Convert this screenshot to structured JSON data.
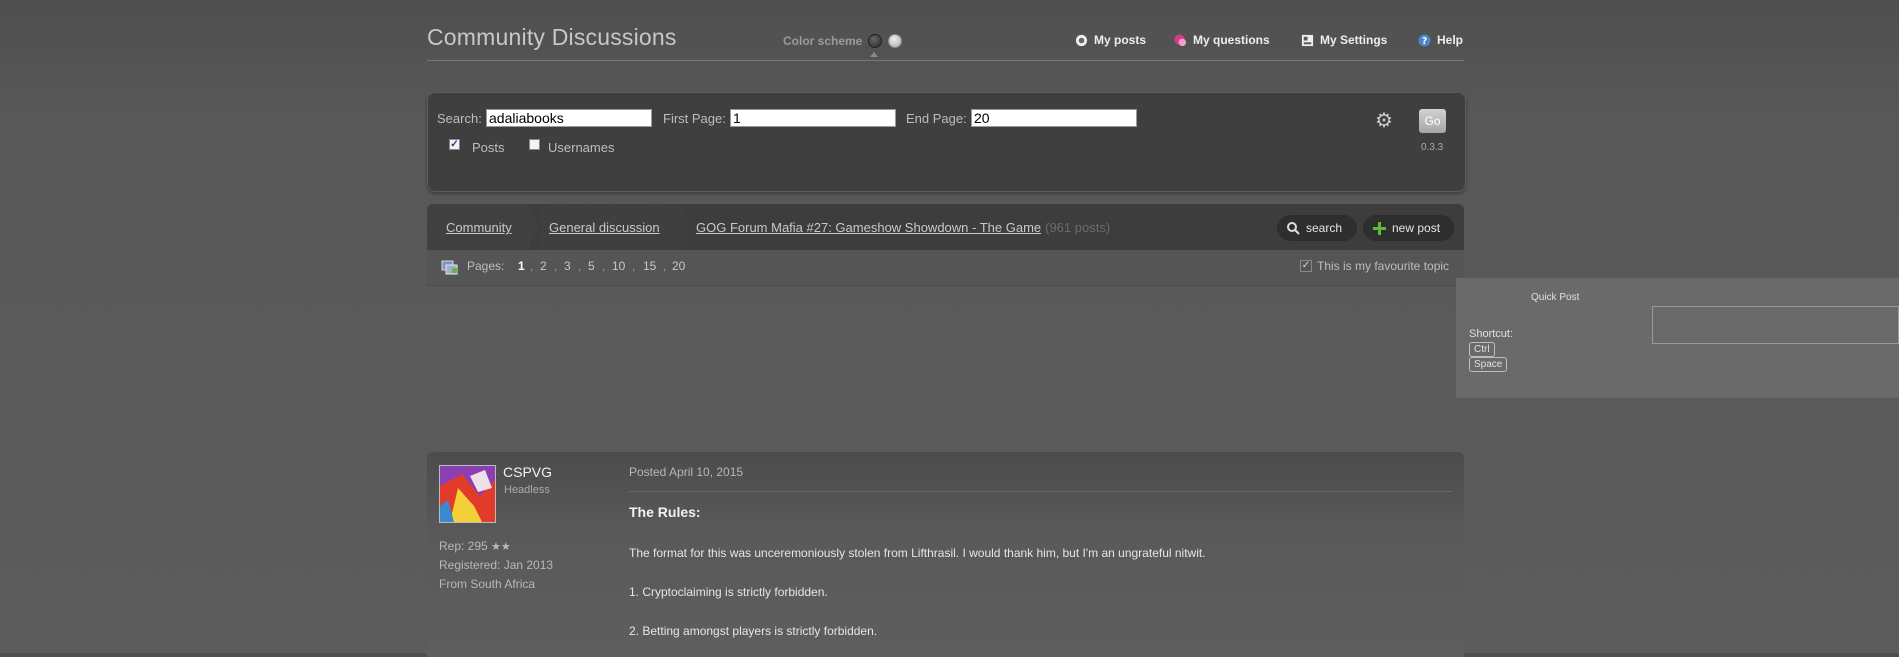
{
  "header": {
    "site_title": "Community Discussions",
    "color_scheme_label": "Color scheme",
    "nav": [
      {
        "label": "My posts",
        "icon": "my-posts-icon"
      },
      {
        "label": "My questions",
        "icon": "my-questions-icon"
      },
      {
        "label": "My Settings",
        "icon": "settings-icon"
      },
      {
        "label": "Help",
        "icon": "help-icon"
      }
    ]
  },
  "search_panel": {
    "search_label": "Search:",
    "search_value": "adaliabooks",
    "first_page_label": "First Page:",
    "first_page_value": "1",
    "end_page_label": "End Page:",
    "end_page_value": "20",
    "posts_label": "Posts",
    "posts_checked": true,
    "usernames_label": "Usernames",
    "usernames_checked": false,
    "go_label": "Go",
    "version": "0.3.3"
  },
  "breadcrumb": {
    "items": [
      "Community",
      "General discussion",
      "GOG Forum Mafia #27: Gameshow Showdown - The Game"
    ],
    "post_count": "(961 posts)",
    "search_label": "search",
    "new_post_label": "new post"
  },
  "pagination": {
    "label": "Pages:",
    "pages": [
      "1",
      "2",
      "3",
      "5",
      "10",
      "15",
      "20"
    ],
    "current": "1",
    "favourite_label": "This is my favourite topic"
  },
  "quick_post": {
    "title": "Quick Post",
    "shortcut_label": "Shortcut:",
    "keys": [
      "Ctrl",
      "Space"
    ]
  },
  "post": {
    "username": "CSPVG",
    "user_title": "Headless",
    "rep": "Rep: 295",
    "registered": "Registered: Jan 2013",
    "from": "From South Africa",
    "posted": "Posted April 10, 2015",
    "heading": "The Rules:",
    "paragraphs": [
      "The format for this was unceremoniously stolen from Lifthrasil. I would thank him, but I'm an ungrateful nitwit.",
      "1. Cryptoclaiming is strictly forbidden.",
      "2. Betting amongst players is strictly forbidden."
    ]
  }
}
